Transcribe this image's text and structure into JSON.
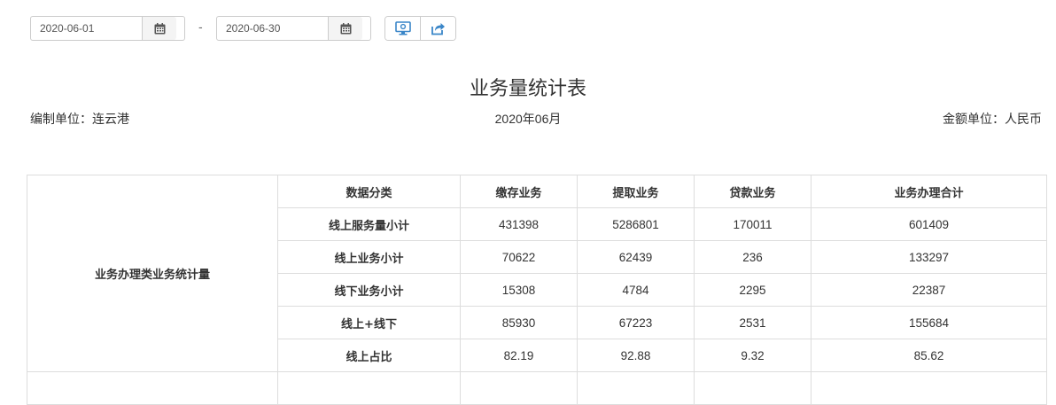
{
  "toolbar": {
    "start_date": "2020-06-01",
    "end_date": "2020-06-30",
    "separator": "-",
    "buttons": [
      {
        "icon": "monitor-icon"
      },
      {
        "icon": "share-export-icon"
      }
    ]
  },
  "report": {
    "title": "业务量统计表",
    "unit_label": "编制单位：连云港",
    "period": "2020年06月",
    "currency_label": "金额单位：人民币"
  },
  "table": {
    "group_label": "业务办理类业务统计量",
    "headers": [
      "数据分类",
      "缴存业务",
      "提取业务",
      "贷款业务",
      "业务办理合计"
    ],
    "rows": [
      {
        "label": "线上服务量小计",
        "values": [
          "431398",
          "5286801",
          "170011",
          "601409"
        ]
      },
      {
        "label": "线上业务小计",
        "values": [
          "70622",
          "62439",
          "236",
          "133297"
        ]
      },
      {
        "label": "线下业务小计",
        "values": [
          "15308",
          "4784",
          "2295",
          "22387"
        ]
      },
      {
        "label": "线上+线下",
        "values": [
          "85930",
          "67223",
          "2531",
          "155684"
        ]
      },
      {
        "label": "线上占比",
        "values": [
          "82.19",
          "92.88",
          "9.32",
          "85.62"
        ]
      }
    ]
  }
}
